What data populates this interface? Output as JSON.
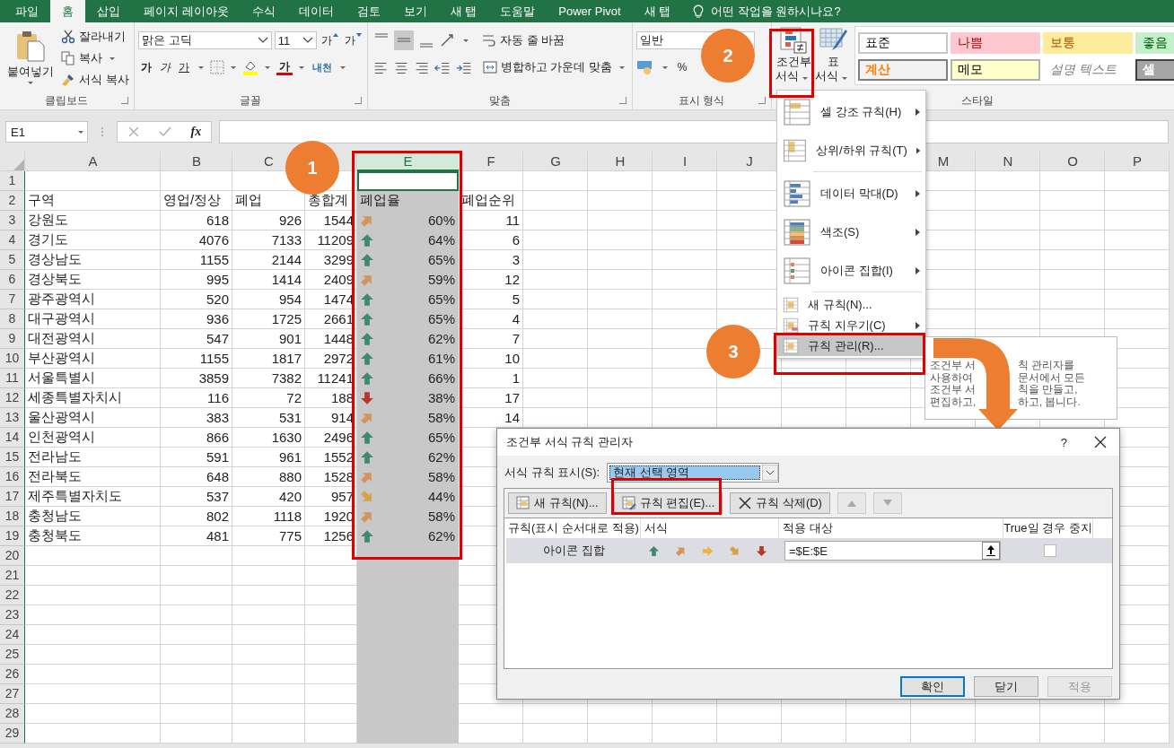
{
  "tabs": [
    {
      "label": "파일",
      "selected": false
    },
    {
      "label": "홈",
      "selected": true
    },
    {
      "label": "삽입",
      "selected": false
    },
    {
      "label": "페이지 레이아웃",
      "selected": false
    },
    {
      "label": "수식",
      "selected": false
    },
    {
      "label": "데이터",
      "selected": false
    },
    {
      "label": "검토",
      "selected": false
    },
    {
      "label": "보기",
      "selected": false
    },
    {
      "label": "새 탭",
      "selected": false
    },
    {
      "label": "도움말",
      "selected": false
    },
    {
      "label": "Power Pivot",
      "selected": false
    },
    {
      "label": "새 탭",
      "selected": false
    }
  ],
  "tell_me": "어떤 작업을 원하시나요?",
  "clipboard": {
    "paste": "붙여넣기",
    "cut": "잘라내기",
    "copy": "복사",
    "format_painter": "서식 복사",
    "label": "클립보드"
  },
  "font": {
    "name": "맑은 고딕",
    "size": "11",
    "grow": "가",
    "shrink": "가",
    "bold": "가",
    "italic": "가",
    "underline": "가",
    "font_color": "가",
    "phonetic": "내천",
    "label": "글꼴"
  },
  "alignment": {
    "vertical": [
      {
        "selected": false
      },
      {
        "selected": true
      },
      {
        "selected": false
      }
    ],
    "wrap": "자동 줄 바꿈",
    "merge": "병합하고 가운데 맞춤",
    "label": "맞춤"
  },
  "number": {
    "format": "일반",
    "percent": "%",
    "label": "표시 형식"
  },
  "styles": {
    "conditional": [
      "조건부",
      "서식"
    ],
    "table": [
      "표",
      "서식"
    ],
    "label": "스타일",
    "gallery": [
      {
        "label": "표준",
        "kind": "normal"
      },
      {
        "label": "나쁨",
        "kind": "bad"
      },
      {
        "label": "보통",
        "kind": "neutral"
      },
      {
        "label": "좋음",
        "kind": "good"
      },
      {
        "label": "계산",
        "kind": "calc"
      },
      {
        "label": "메모",
        "kind": "note"
      },
      {
        "label": "설명 텍스트",
        "kind": "explanatory"
      },
      {
        "label": "셀",
        "kind": "check"
      }
    ]
  },
  "formula_bar": {
    "name_box": "E1",
    "fx": "fx"
  },
  "sheet": {
    "columns": [
      {
        "label": "A",
        "selected": false
      },
      {
        "label": "B",
        "selected": false
      },
      {
        "label": "C",
        "selected": false
      },
      {
        "label": "E",
        "selected": true
      },
      {
        "label": "F",
        "selected": false
      },
      {
        "label": "G",
        "selected": false
      },
      {
        "label": "H",
        "selected": false
      },
      {
        "label": "I",
        "selected": false
      },
      {
        "label": "J",
        "selected": false
      },
      {
        "label": "M",
        "selected": false
      },
      {
        "label": "N",
        "selected": false
      },
      {
        "label": "O",
        "selected": false
      },
      {
        "label": "P",
        "selected": false
      }
    ],
    "rows": [
      {
        "number": "1",
        "kind": "blank"
      },
      {
        "number": "2",
        "kind": "header",
        "cells": [
          "구역",
          "영업/정상",
          "폐업",
          "총합계",
          "폐업율",
          "폐업순위"
        ]
      },
      {
        "number": "3",
        "kind": "data",
        "region": "강원도",
        "open": "618",
        "closed": "926",
        "total": "1544",
        "icon": {
          "kind": "up-right"
        },
        "rate": "60%",
        "rank": "11"
      },
      {
        "number": "4",
        "kind": "data",
        "region": "경기도",
        "open": "4076",
        "closed": "7133",
        "total": "11209",
        "icon": {
          "kind": "up"
        },
        "rate": "64%",
        "rank": "6"
      },
      {
        "number": "5",
        "kind": "data",
        "region": "경상남도",
        "open": "1155",
        "closed": "2144",
        "total": "3299",
        "icon": {
          "kind": "up"
        },
        "rate": "65%",
        "rank": "3"
      },
      {
        "number": "6",
        "kind": "data",
        "region": "경상북도",
        "open": "995",
        "closed": "1414",
        "total": "2409",
        "icon": {
          "kind": "up-right"
        },
        "rate": "59%",
        "rank": "12"
      },
      {
        "number": "7",
        "kind": "data",
        "region": "광주광역시",
        "open": "520",
        "closed": "954",
        "total": "1474",
        "icon": {
          "kind": "up"
        },
        "rate": "65%",
        "rank": "5"
      },
      {
        "number": "8",
        "kind": "data",
        "region": "대구광역시",
        "open": "936",
        "closed": "1725",
        "total": "2661",
        "icon": {
          "kind": "up"
        },
        "rate": "65%",
        "rank": "4"
      },
      {
        "number": "9",
        "kind": "data",
        "region": "대전광역시",
        "open": "547",
        "closed": "901",
        "total": "1448",
        "icon": {
          "kind": "up"
        },
        "rate": "62%",
        "rank": "7"
      },
      {
        "number": "10",
        "kind": "data",
        "region": "부산광역시",
        "open": "1155",
        "closed": "1817",
        "total": "2972",
        "icon": {
          "kind": "up"
        },
        "rate": "61%",
        "rank": "10"
      },
      {
        "number": "11",
        "kind": "data",
        "region": "서울특별시",
        "open": "3859",
        "closed": "7382",
        "total": "11241",
        "icon": {
          "kind": "up"
        },
        "rate": "66%",
        "rank": "1"
      },
      {
        "number": "12",
        "kind": "data",
        "region": "세종특별자치시",
        "open": "116",
        "closed": "72",
        "total": "188",
        "icon": {
          "kind": "down"
        },
        "rate": "38%",
        "rank": "17"
      },
      {
        "number": "13",
        "kind": "data",
        "region": "울산광역시",
        "open": "383",
        "closed": "531",
        "total": "914",
        "icon": {
          "kind": "up-right"
        },
        "rate": "58%",
        "rank": "14"
      },
      {
        "number": "14",
        "kind": "data",
        "region": "인천광역시",
        "open": "866",
        "closed": "1630",
        "total": "2496",
        "icon": {
          "kind": "up"
        },
        "rate": "65%"
      },
      {
        "number": "15",
        "kind": "data",
        "region": "전라남도",
        "open": "591",
        "closed": "961",
        "total": "1552",
        "icon": {
          "kind": "up"
        },
        "rate": "62%"
      },
      {
        "number": "16",
        "kind": "data",
        "region": "전라북도",
        "open": "648",
        "closed": "880",
        "total": "1528",
        "icon": {
          "kind": "up-right"
        },
        "rate": "58%"
      },
      {
        "number": "17",
        "kind": "data",
        "region": "제주특별자치도",
        "open": "537",
        "closed": "420",
        "total": "957",
        "icon": {
          "kind": "down-right"
        },
        "rate": "44%"
      },
      {
        "number": "18",
        "kind": "data",
        "region": "충청남도",
        "open": "802",
        "closed": "1118",
        "total": "1920",
        "icon": {
          "kind": "up-right"
        },
        "rate": "58%"
      },
      {
        "number": "19",
        "kind": "data",
        "region": "충청북도",
        "open": "481",
        "closed": "775",
        "total": "1256",
        "icon": {
          "kind": "up"
        },
        "rate": "62%"
      },
      {
        "number": "20",
        "kind": "blank"
      },
      {
        "number": "21",
        "kind": "blank"
      },
      {
        "number": "22",
        "kind": "blank"
      },
      {
        "number": "23",
        "kind": "blank"
      },
      {
        "number": "24",
        "kind": "blank"
      },
      {
        "number": "25",
        "kind": "blank"
      },
      {
        "number": "26",
        "kind": "blank"
      },
      {
        "number": "27",
        "kind": "blank"
      },
      {
        "number": "28",
        "kind": "blank"
      },
      {
        "number": "29",
        "kind": "blank"
      }
    ]
  },
  "menu": [
    [
      {
        "label": "셀 강조 규칙(H)",
        "kind": "large",
        "submenu": true,
        "highlighted": false
      },
      {
        "label": "상위/하위 규칙(T)",
        "kind": "large",
        "submenu": true,
        "highlighted": false
      }
    ],
    [
      {
        "label": "데이터 막대(D)",
        "kind": "large",
        "submenu": true,
        "highlighted": false
      },
      {
        "label": "색조(S)",
        "kind": "large",
        "submenu": true,
        "highlighted": false
      },
      {
        "label": "아이콘 집합(I)",
        "kind": "large",
        "submenu": true,
        "highlighted": false
      }
    ],
    [
      {
        "label": "새 규칙(N)...",
        "kind": "small",
        "submenu": false,
        "highlighted": false
      },
      {
        "label": "규칙 지우기(C)",
        "kind": "small",
        "submenu": true,
        "highlighted": false
      },
      {
        "label": "규칙 관리(R)...",
        "kind": "small",
        "submenu": false,
        "highlighted": true
      }
    ]
  ],
  "tooltip": [
    {
      "left": "조건부 서",
      "right": "칙 관리자를"
    },
    {
      "left": "사용하여",
      "right": "문서에서 모든"
    },
    {
      "left": "조건부 서",
      "right": "칙을 만들고,"
    },
    {
      "left": "편집하고,",
      "right": "하고, 봅니다."
    }
  ],
  "dialog": {
    "title": "조건부 서식 규칙 관리자",
    "help": "?",
    "show_label": "서식 규칙 표시(S):",
    "show_value": "현재 선택 영역",
    "toolbar": [
      {
        "label": "새 규칙(N)...",
        "kind": "new"
      },
      {
        "label": "규칙 편집(E)...",
        "kind": "edit"
      },
      {
        "label": "규칙 삭제(D)",
        "kind": "delete"
      },
      {
        "kind": "up",
        "disabled": true
      },
      {
        "kind": "down",
        "disabled": true
      }
    ],
    "columns": [
      "규칙(표시 순서대로 적용)",
      "서식",
      "적용 대상",
      "True일 경우 중지"
    ],
    "rules": [
      {
        "name": "아이콘 집합",
        "icons": [
          {
            "kind": "up"
          },
          {
            "kind": "up-right"
          },
          {
            "kind": "right"
          },
          {
            "kind": "down-right"
          },
          {
            "kind": "down"
          }
        ],
        "applies_to": "=$E:$E",
        "stop_if_true": false,
        "selected": true
      }
    ],
    "buttons": [
      {
        "label": "확인",
        "default": true,
        "disabled": false
      },
      {
        "label": "닫기",
        "default": false,
        "disabled": false
      },
      {
        "label": "적용",
        "default": false,
        "disabled": true
      }
    ]
  },
  "callouts": [
    "1",
    "2",
    "3"
  ]
}
